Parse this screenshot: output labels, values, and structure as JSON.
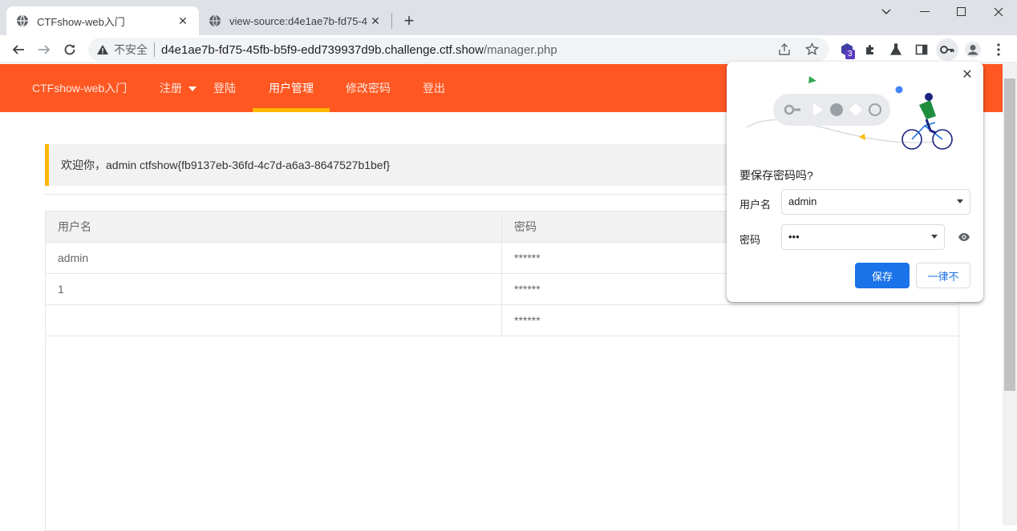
{
  "tabs": [
    {
      "title": "CTFshow-web入门",
      "active": true
    },
    {
      "title": "view-source:d4e1ae7b-fd75-4",
      "active": false
    }
  ],
  "toolbar": {
    "security_text": "不安全",
    "url_host": "d4e1ae7b-fd75-45fb-b5f9-edd739937d9b.challenge.ctf.show",
    "url_path": "/manager.php",
    "extension_badge": "3"
  },
  "nav": {
    "brand": "CTFshow-web入门",
    "items": [
      {
        "label": "注册",
        "has_dropdown": true
      },
      {
        "label": "登陆"
      },
      {
        "label": "用户管理",
        "active": true
      },
      {
        "label": "修改密码"
      },
      {
        "label": "登出"
      }
    ]
  },
  "welcome": "欢迎你，admin ctfshow{fb9137eb-36fd-4c7d-a6a3-8647527b1bef}",
  "table": {
    "headers": [
      "用户名",
      "密码"
    ],
    "rows": [
      [
        "admin",
        "******"
      ],
      [
        "1",
        "******"
      ],
      [
        "",
        "******"
      ]
    ]
  },
  "password_bubble": {
    "title": "要保存密码吗?",
    "username_label": "用户名",
    "username_value": "admin",
    "password_label": "密码",
    "password_value": "•••",
    "save_label": "保存",
    "never_label": "一律不"
  },
  "colors": {
    "nav_bg": "#ff5722",
    "accent_yellow": "#ffb800",
    "chrome_blue": "#1a73e8"
  }
}
